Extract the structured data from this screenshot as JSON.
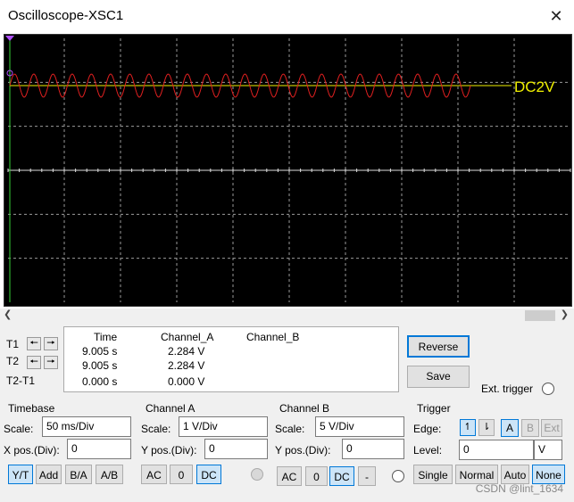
{
  "window": {
    "title": "Oscilloscope-XSC1",
    "close_icon": "close-icon"
  },
  "scope": {
    "background": "#000000",
    "trace_color": "#e02020",
    "channel_b_color": "#f0f000",
    "channel_label": "DC2V",
    "grid_color": "#9a9a9a"
  },
  "readout": {
    "t1_label": "T1",
    "t2_label": "T2",
    "t2t1_label": "T2-T1",
    "headers": [
      "Time",
      "Channel_A",
      "Channel_B"
    ],
    "rows": [
      [
        "9.005 s",
        "2.284 V",
        ""
      ],
      [
        "9.005 s",
        "2.284 V",
        ""
      ],
      [
        "0.000 s",
        "0.000 V",
        ""
      ]
    ],
    "reverse_label": "Reverse",
    "save_label": "Save",
    "ext_trigger_label": "Ext. trigger"
  },
  "timebase": {
    "title": "Timebase",
    "scale_label": "Scale:",
    "scale_value": "50 ms/Div",
    "xpos_label": "X pos.(Div):",
    "xpos_value": "0",
    "buttons": [
      "Y/T",
      "Add",
      "B/A",
      "A/B"
    ]
  },
  "channel_a": {
    "title": "Channel A",
    "scale_label": "Scale:",
    "scale_value": "1  V/Div",
    "ypos_label": "Y pos.(Div):",
    "ypos_value": "0",
    "buttons": [
      "AC",
      "0",
      "DC"
    ]
  },
  "channel_b": {
    "title": "Channel B",
    "scale_label": "Scale:",
    "scale_value": "5  V/Div",
    "ypos_label": "Y pos.(Div):",
    "ypos_value": "0",
    "buttons": [
      "AC",
      "0",
      "DC",
      "-"
    ]
  },
  "trigger": {
    "title": "Trigger",
    "edge_label": "Edge:",
    "edge_sources": [
      "A",
      "B",
      "Ext"
    ],
    "level_label": "Level:",
    "level_value": "0",
    "level_unit": "V",
    "modes": [
      "Single",
      "Normal",
      "Auto",
      "None"
    ]
  },
  "watermark": "CSDN @lint_1634"
}
